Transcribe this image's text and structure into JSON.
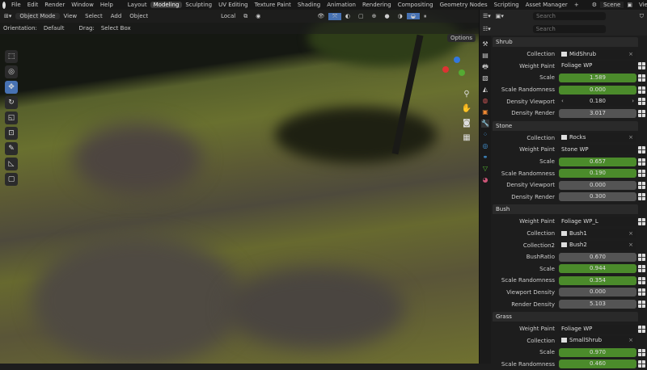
{
  "menu": [
    "File",
    "Edit",
    "Render",
    "Window",
    "Help"
  ],
  "workspaces": [
    "Layout",
    "Modeling",
    "Sculpting",
    "UV Editing",
    "Texture Paint",
    "Shading",
    "Animation",
    "Rendering",
    "Compositing",
    "Geometry Nodes",
    "Scripting",
    "Asset Manager"
  ],
  "active_workspace": "Modeling",
  "scene": "Scene",
  "view_layer": "ViewLayer",
  "viewport": {
    "mode": "Object Mode",
    "menus": [
      "View",
      "Select",
      "Add",
      "Object"
    ],
    "transform": "Local",
    "orientation_label": "Orientation:",
    "orientation": "Default",
    "drag_label": "Drag:",
    "drag": "Select Box",
    "options": "Options"
  },
  "outliner_search": "Search",
  "properties_search": "Search",
  "sections": [
    {
      "title": "Shrub",
      "rows": [
        {
          "label": "Collection",
          "value": "MidShrub",
          "kind": "collection"
        },
        {
          "label": "Weight Paint",
          "value": "Foliage WP",
          "kind": "text"
        },
        {
          "label": "Scale",
          "value": "1.589",
          "kind": "green"
        },
        {
          "label": "Scale Randomness",
          "value": "0.000",
          "kind": "green"
        },
        {
          "label": "Density Viewport",
          "value": "0.180",
          "kind": "dark"
        },
        {
          "label": "Density Render",
          "value": "3.017",
          "kind": "num"
        }
      ]
    },
    {
      "title": "Stone",
      "rows": [
        {
          "label": "Collection",
          "value": "Rocks",
          "kind": "collection"
        },
        {
          "label": "Weight Paint",
          "value": "Stone WP",
          "kind": "text"
        },
        {
          "label": "Scale",
          "value": "0.657",
          "kind": "green"
        },
        {
          "label": "Scale Randomness",
          "value": "0.190",
          "kind": "green"
        },
        {
          "label": "Density Viewport",
          "value": "0.000",
          "kind": "num"
        },
        {
          "label": "Density Render",
          "value": "0.300",
          "kind": "num"
        }
      ]
    },
    {
      "title": "Bush",
      "rows": [
        {
          "label": "Weight Paint",
          "value": "Foliage WP_L",
          "kind": "text"
        },
        {
          "label": "Collection",
          "value": "Bush1",
          "kind": "collection"
        },
        {
          "label": "Collection2",
          "value": "Bush2",
          "kind": "collection"
        },
        {
          "label": "BushRatio",
          "value": "0.670",
          "kind": "num"
        },
        {
          "label": "Scale",
          "value": "0.944",
          "kind": "green"
        },
        {
          "label": "Scale Randomness",
          "value": "0.354",
          "kind": "green"
        },
        {
          "label": "Viewport Density",
          "value": "0.000",
          "kind": "num"
        },
        {
          "label": "Render Density",
          "value": "5.103",
          "kind": "num"
        }
      ]
    },
    {
      "title": "Grass",
      "rows": [
        {
          "label": "Weight Paint",
          "value": "Foliage WP",
          "kind": "text"
        },
        {
          "label": "Collection",
          "value": "SmallShrub",
          "kind": "collection"
        },
        {
          "label": "Scale",
          "value": "0.970",
          "kind": "green"
        },
        {
          "label": "Scale Randomness",
          "value": "0.460",
          "kind": "green"
        }
      ]
    }
  ]
}
